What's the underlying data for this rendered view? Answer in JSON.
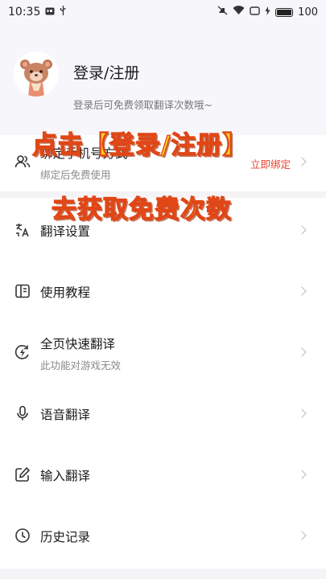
{
  "status_bar": {
    "time": "10:35",
    "battery": "100"
  },
  "header": {
    "title": "登录/注册",
    "subtitle": "登录后可免费领取翻译次数哦~"
  },
  "menu": {
    "bind": {
      "label": "绑定手机号方式",
      "sub": "绑定后免费使用",
      "action": "立即绑定"
    },
    "translate_settings": {
      "label": "翻译设置"
    },
    "tutorial": {
      "label": "使用教程"
    },
    "fullpage": {
      "label": "全页快速翻译",
      "sub": "此功能对游戏无效"
    },
    "voice": {
      "label": "语音翻译"
    },
    "input": {
      "label": "输入翻译"
    },
    "history": {
      "label": "历史记录"
    }
  },
  "overlay": {
    "line1": "点击【登录/注册】",
    "line2": "去获取免费次数"
  },
  "colors": {
    "accent": "#e9412c",
    "overlay_fill": "#ffd21a",
    "overlay_stroke": "#e04616"
  }
}
